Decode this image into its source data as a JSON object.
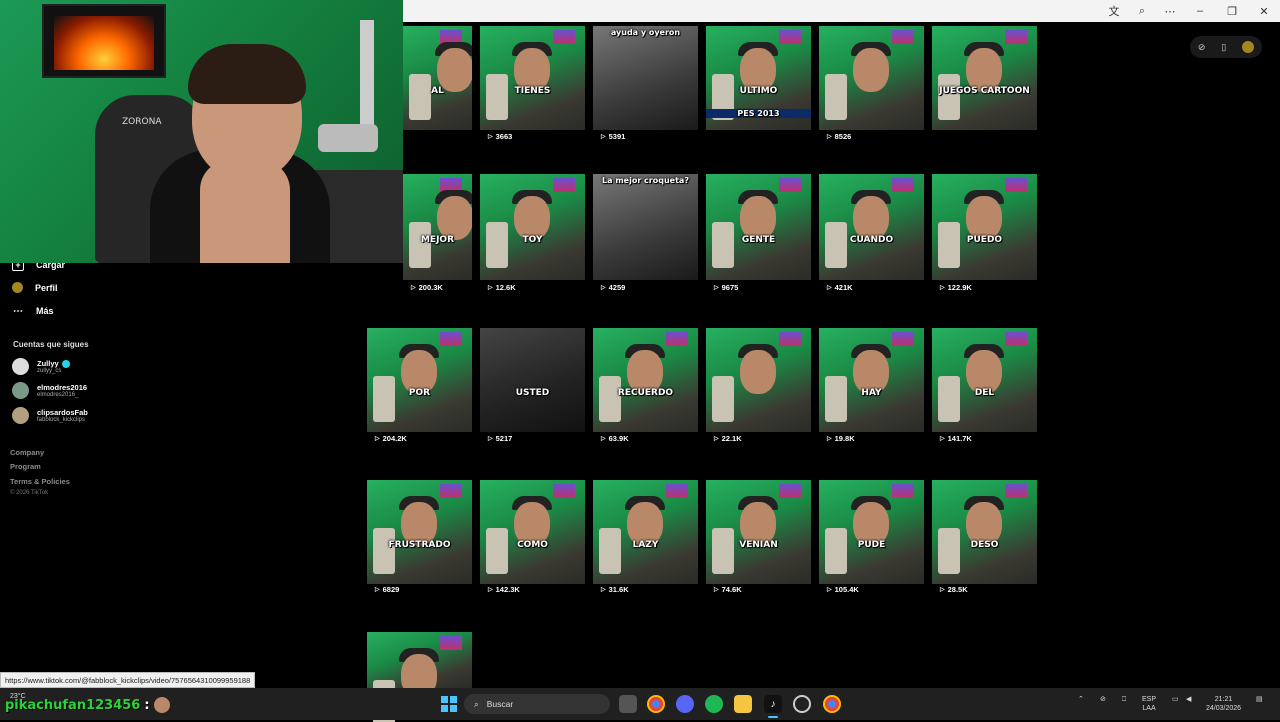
{
  "colors": {
    "accent": "#20d5ec",
    "chat_name": "#2bd33b",
    "green_screen": "#1c9a55"
  },
  "webcam": {
    "chair_label": "ZORONA"
  },
  "sidebar": {
    "items": [
      {
        "label": "Cargar",
        "icon": "upload-icon"
      },
      {
        "label": "Perfil",
        "icon": "profile-icon"
      },
      {
        "label": "Más",
        "icon": "more-icon"
      }
    ],
    "following_heading": "Cuentas que sigues",
    "accounts": [
      {
        "name": "Zullyy",
        "handle": "zullyy_cs",
        "verified": true
      },
      {
        "name": "elmodres2016",
        "handle": "elmodres2016_",
        "verified": false
      },
      {
        "name": "clipsardosFab",
        "handle": "fabblock_kickclips",
        "verified": false
      }
    ],
    "footer_links": [
      "Company",
      "Program",
      "Terms & Policies"
    ],
    "copyright": "© 2026 TikTok"
  },
  "videos": [
    {
      "word": "AL",
      "views": ""
    },
    {
      "word": "TIENES",
      "views": "3663"
    },
    {
      "word": "",
      "views": "5391",
      "caption": "ayuda y oyeron"
    },
    {
      "word": "ULTIMO",
      "views": "",
      "overlay": "PES 2013"
    },
    {
      "word": "",
      "views": "8526"
    },
    {
      "word": "JUEGOS CARTOON",
      "views": ""
    },
    {
      "word": "MEJOR",
      "views": "200.3K"
    },
    {
      "word": "TOY",
      "views": "12.6K"
    },
    {
      "word": "",
      "views": "4259",
      "caption": "La mejor croqueta?"
    },
    {
      "word": "GENTE",
      "views": "9675"
    },
    {
      "word": "CUANDO",
      "views": "421K"
    },
    {
      "word": "PUEDO",
      "views": "122.9K"
    },
    {
      "word": "POR",
      "views": "204.2K"
    },
    {
      "word": "USTED",
      "views": "5217"
    },
    {
      "word": "RECUERDO",
      "views": "63.9K"
    },
    {
      "word": "",
      "views": "22.1K"
    },
    {
      "word": "HAY",
      "views": "19.8K"
    },
    {
      "word": "DEL",
      "views": "141.7K"
    },
    {
      "word": "FRUSTRADO",
      "views": "6829"
    },
    {
      "word": "COMO",
      "views": "142.3K"
    },
    {
      "word": "LAZY",
      "views": "31.6K"
    },
    {
      "word": "VENIAN",
      "views": "74.6K"
    },
    {
      "word": "PUDE",
      "views": "105.4K"
    },
    {
      "word": "DESO",
      "views": "28.5K"
    },
    {
      "word": "",
      "views": ""
    }
  ],
  "status_url": "https://www.tiktok.com/@fabblock_kickclips/video/7576564310099959188",
  "taskbar": {
    "weather": "23°C",
    "chat_user": "pikachufan123456",
    "chat_colon": ":",
    "search_placeholder": "Buscar",
    "lang_top": "ESP",
    "lang_bottom": "LAA",
    "time": "21:21",
    "date": "24/03/2026"
  }
}
